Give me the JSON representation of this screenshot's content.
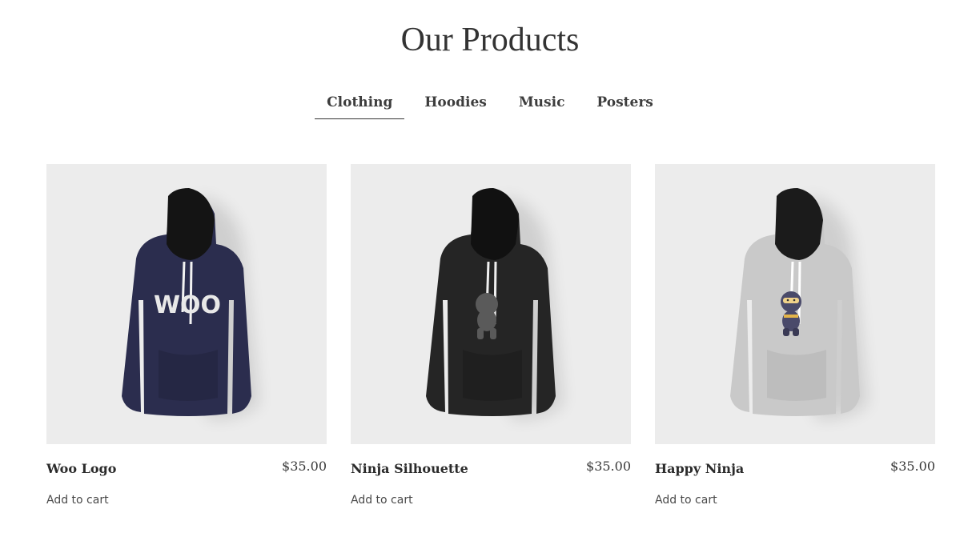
{
  "page": {
    "title": "Our Products"
  },
  "tabs": [
    {
      "label": "Clothing",
      "active": true
    },
    {
      "label": "Hoodies",
      "active": false
    },
    {
      "label": "Music",
      "active": false
    },
    {
      "label": "Posters",
      "active": false
    }
  ],
  "products": [
    {
      "name": "Woo Logo",
      "price": "$35.00",
      "cart_label": "Add to cart",
      "hoodie_color": "#2b2d4e",
      "graphic": "WOO",
      "graphic_icon": "woo-logo-print"
    },
    {
      "name": "Ninja Silhouette",
      "price": "$35.00",
      "cart_label": "Add to cart",
      "hoodie_color": "#252525",
      "graphic_icon": "ninja-silhouette-print"
    },
    {
      "name": "Happy Ninja",
      "price": "$35.00",
      "cart_label": "Add to cart",
      "hoodie_color": "#c9c9c9",
      "graphic_icon": "happy-ninja-print"
    }
  ],
  "colors": {
    "image_bg": "#ececec",
    "text": "#2b2b2b"
  }
}
